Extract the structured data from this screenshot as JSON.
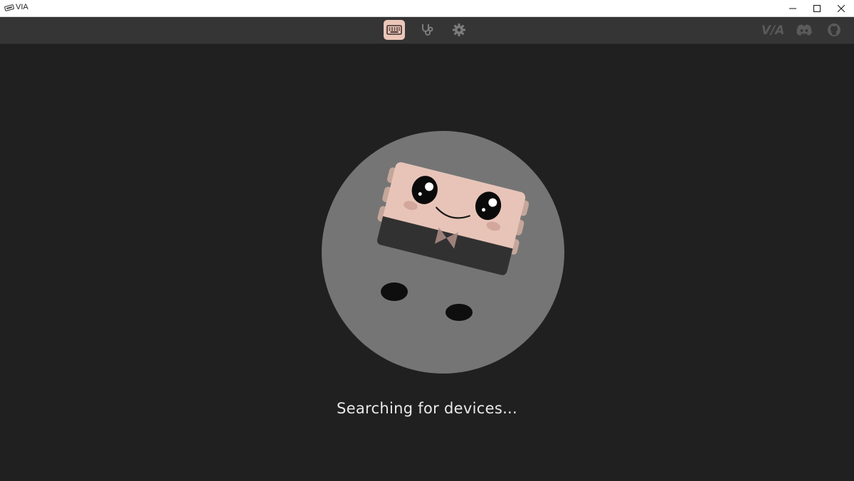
{
  "window": {
    "title": "VIA",
    "controls": [
      "minimize",
      "maximize",
      "close"
    ]
  },
  "toolbar": {
    "tabs": [
      {
        "icon": "keyboard-icon",
        "active": true
      },
      {
        "icon": "stethoscope-icon",
        "active": false
      },
      {
        "icon": "gear-icon",
        "active": false
      }
    ],
    "links": [
      {
        "icon": "via-logo",
        "text": "V/A"
      },
      {
        "icon": "discord-icon"
      },
      {
        "icon": "github-icon"
      }
    ]
  },
  "main": {
    "status": "Searching for devices..."
  },
  "colors": {
    "background": "#202020",
    "toolbar": "#353535",
    "accent": "#ecc6b9",
    "mascot_circle": "#757575"
  }
}
